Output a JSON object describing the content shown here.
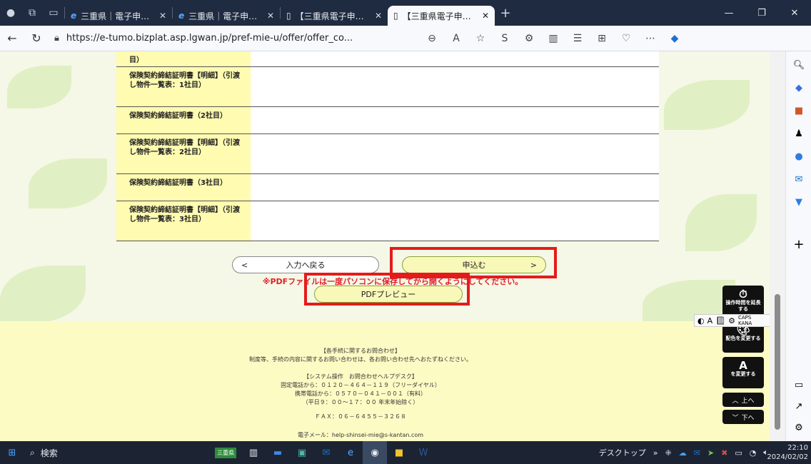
{
  "browser": {
    "tabs": [
      {
        "label": "三重県｜電子申請・",
        "icon": "ie-icon",
        "active": false
      },
      {
        "label": "三重県｜電子申請・",
        "icon": "ie-icon",
        "active": false
      },
      {
        "label": "【三重県電子申請・",
        "icon": "page-icon",
        "active": false
      },
      {
        "label": "【三重県電子申請・届",
        "icon": "page-icon",
        "active": true
      }
    ],
    "url": "https://e-tumo.bizplat.asp.lgwan.jp/pref-mie-u/offer/offer_co..."
  },
  "table": {
    "rows": [
      {
        "label": "目）"
      },
      {
        "label": "保険契約締結証明書【明細】（引渡し物件一覧表：1社目）"
      },
      {
        "label": "保険契約締結証明書（2社目）"
      },
      {
        "label": "保険契約締結証明書【明細】（引渡し物件一覧表：2社目）"
      },
      {
        "label": "保険契約締結証明書（3社目）"
      },
      {
        "label": "保険契約締結証明書【明細】（引渡し物件一覧表：3社目）"
      }
    ]
  },
  "buttons": {
    "back_label": "入力へ戻る",
    "back_arrow": "<",
    "apply_label": "申込む",
    "apply_arrow": ">",
    "pdf_label": "PDFプレビュー"
  },
  "warning": "※PDFファイルは一度パソコンに保存してから開くようにしてください。",
  "footer": {
    "title": "【各手続に関するお問合わせ】",
    "desc": "制度等、手続の内容に関するお問い合わせは、各お問い合わせ先へおたずねください。",
    "helpdesk": "【システム操作　お問合わせヘルプデスク】",
    "fixed": "固定電話から：０１２０－４６４－１１９（フリーダイヤル）",
    "mobile": "携帯電話から：０５７０－０４１－００１（有料）",
    "hours": "（平日９：００～１７：００ 年末年始除く）",
    "fax": "ＦＡＸ：０６－６４５５－３２６８",
    "email": "電子メール：help-shinsei-mie@s-kantan.com"
  },
  "float_widgets": {
    "extend_time": "操作時間を延長する",
    "color_change": "配色を変更する",
    "text_size": "を変更する",
    "up": "上へ",
    "down": "下へ"
  },
  "ime": {
    "mode": "A",
    "caps": "CAPS",
    "kana": "KANA"
  },
  "taskbar": {
    "search_placeholder": "検索",
    "app_badge": "三重県",
    "desktop_label": "デスクトップ",
    "time": "22:10",
    "date": "2024/02/02"
  },
  "colors": {
    "highlight": "#e41b1b",
    "label_bg": "#fffbb0",
    "warning_text": "#e0202a",
    "footer_bg": "#fdfbc4"
  }
}
